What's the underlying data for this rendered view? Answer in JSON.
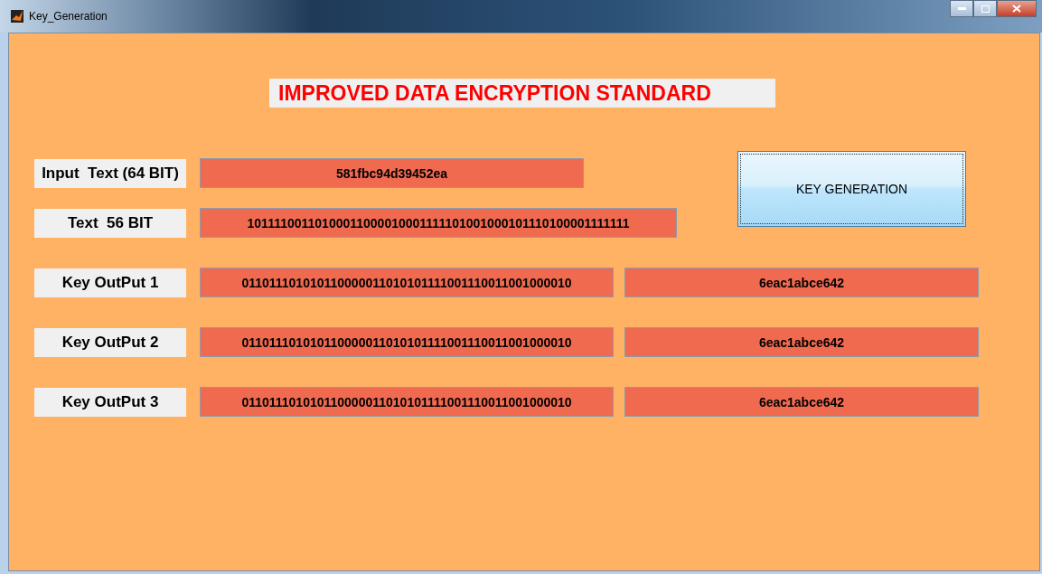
{
  "window": {
    "title": "Key_Generation"
  },
  "heading": "IMPROVED DATA ENCRYPTION STANDARD",
  "inputs": [
    {
      "label": "Input  Text (64 BIT)",
      "value": "581fbc94d39452ea"
    },
    {
      "label": "Text  56 BIT",
      "value": "10111100110100011000010001111101001000101110100001111111"
    }
  ],
  "button": "KEY GENERATION",
  "key_outputs": [
    {
      "label": "Key OutPut 1",
      "binary": "011011101010110000011010101111001110011001000010",
      "hex": "6eac1abce642"
    },
    {
      "label": "Key OutPut 2",
      "binary": "011011101010110000011010101111001110011001000010",
      "hex": "6eac1abce642"
    },
    {
      "label": "Key OutPut 3",
      "binary": "011011101010110000011010101111001110011001000010",
      "hex": "6eac1abce642"
    }
  ]
}
